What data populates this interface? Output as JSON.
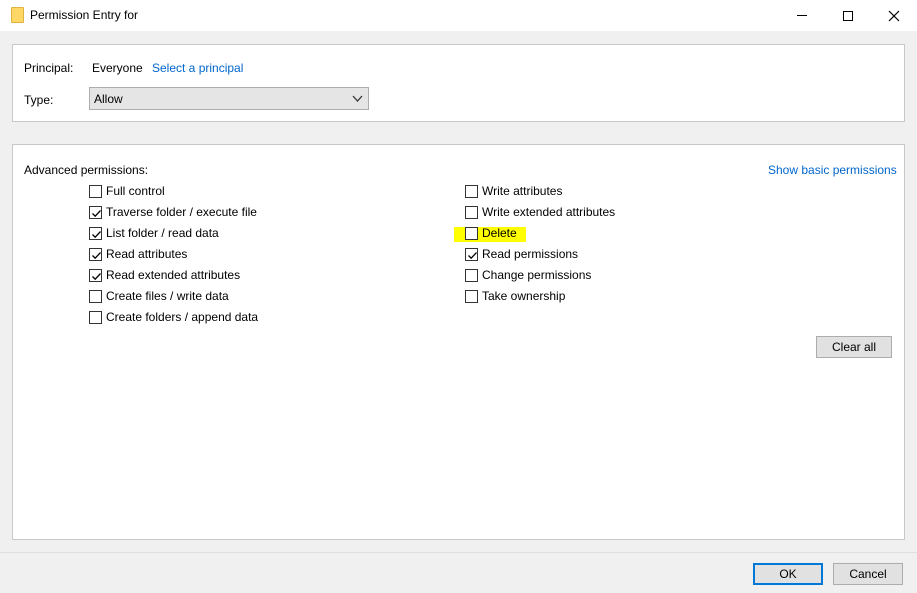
{
  "window": {
    "title": "Permission Entry for"
  },
  "principal": {
    "label": "Principal:",
    "value": "Everyone",
    "select_link": "Select a principal"
  },
  "type": {
    "label": "Type:",
    "selected": "Allow"
  },
  "advanced": {
    "heading": "Advanced permissions:",
    "show_basic_link": "Show basic permissions",
    "left_column": [
      {
        "label": "Full control",
        "checked": false
      },
      {
        "label": "Traverse folder / execute file",
        "checked": true
      },
      {
        "label": "List folder / read data",
        "checked": true
      },
      {
        "label": "Read attributes",
        "checked": true
      },
      {
        "label": "Read extended attributes",
        "checked": true
      },
      {
        "label": "Create files / write data",
        "checked": false
      },
      {
        "label": "Create folders / append data",
        "checked": false
      }
    ],
    "right_column": [
      {
        "label": "Write attributes",
        "checked": false
      },
      {
        "label": "Write extended attributes",
        "checked": false
      },
      {
        "label": "Delete",
        "checked": false,
        "highlighted": true,
        "highlight_color": "#ffff00"
      },
      {
        "label": "Read permissions",
        "checked": true
      },
      {
        "label": "Change permissions",
        "checked": false
      },
      {
        "label": "Take ownership",
        "checked": false
      }
    ],
    "clear_all_label": "Clear all"
  },
  "footer": {
    "ok_label": "OK",
    "cancel_label": "Cancel"
  },
  "colors": {
    "link": "#0066cc",
    "highlight": "#ffff00",
    "default_button_border": "#0078d7"
  }
}
